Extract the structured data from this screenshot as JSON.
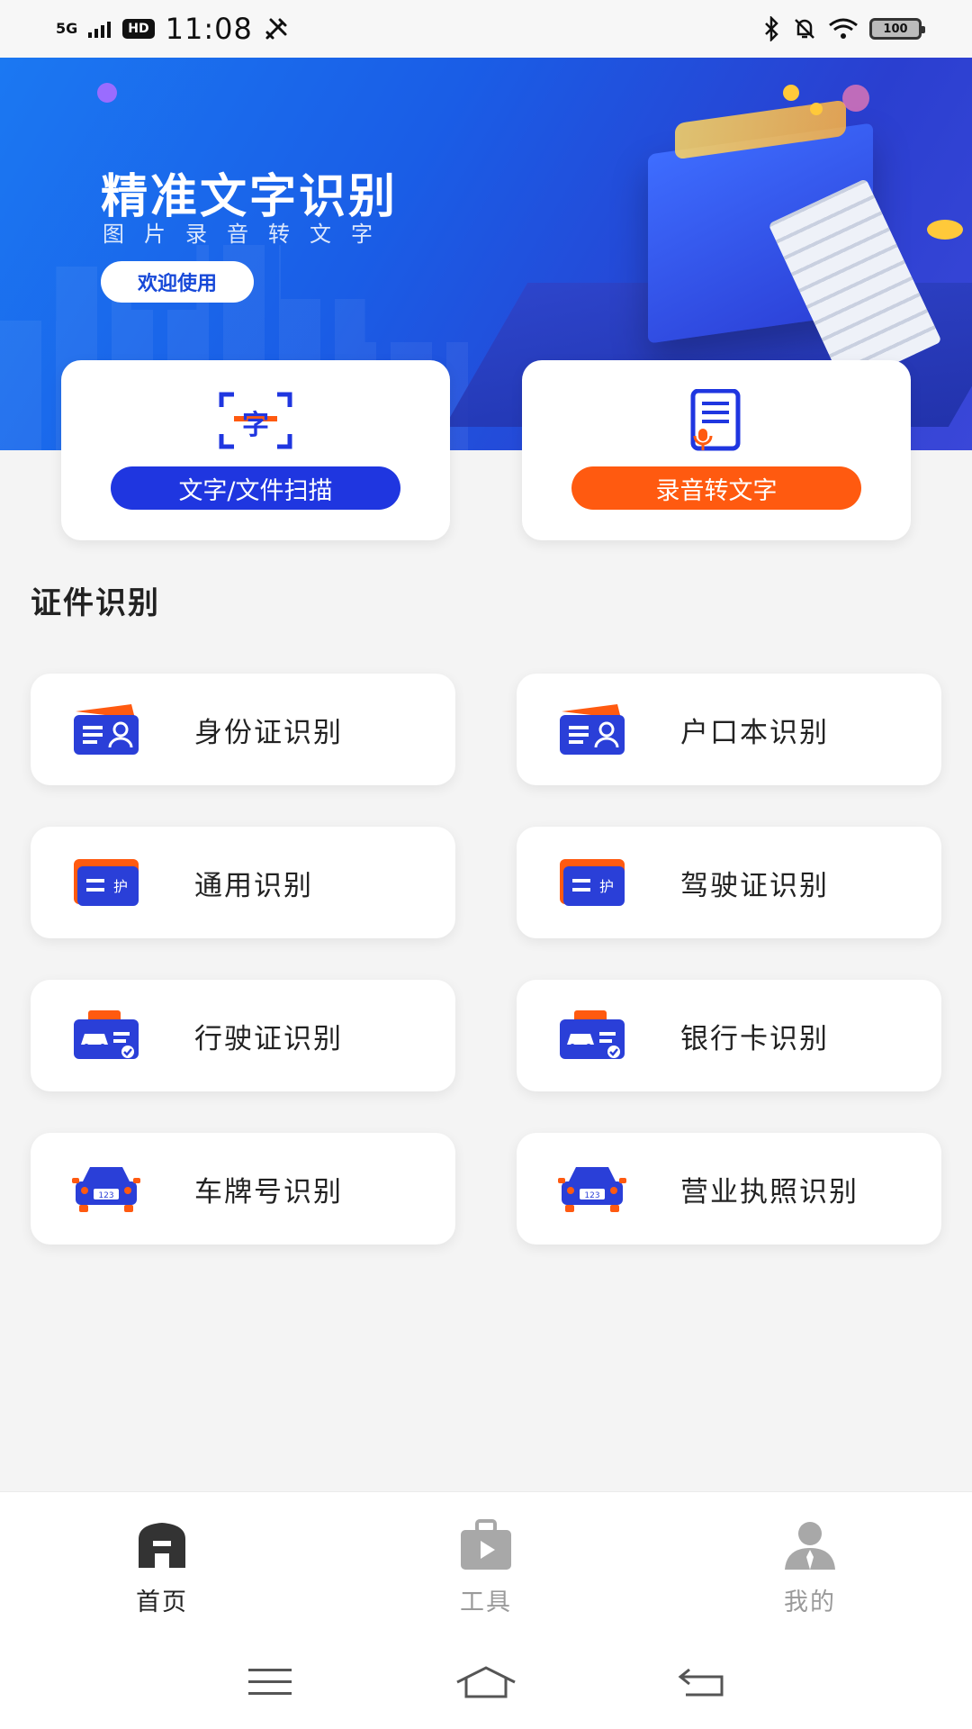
{
  "status_bar": {
    "signal": "5G",
    "hd": "HD",
    "time": "11:08",
    "battery": "100"
  },
  "banner": {
    "title": "精准文字识别",
    "subtitle": "图片录音转文字",
    "welcome_button": "欢迎使用"
  },
  "quick_actions": {
    "scan": {
      "label": "文字/文件扫描",
      "color": "#1f36e0"
    },
    "audio": {
      "label": "录音转文字",
      "color": "#ff5a10"
    }
  },
  "section": {
    "title": "证件识别"
  },
  "id_items": [
    {
      "label": "身份证识别",
      "icon": "id-card-icon"
    },
    {
      "label": "户口本识别",
      "icon": "household-book-icon"
    },
    {
      "label": "通用识别",
      "icon": "passport-icon"
    },
    {
      "label": "驾驶证识别",
      "icon": "driver-license-icon"
    },
    {
      "label": "行驶证识别",
      "icon": "vehicle-license-icon"
    },
    {
      "label": "银行卡识别",
      "icon": "bank-card-icon"
    },
    {
      "label": "车牌号识别",
      "icon": "license-plate-icon"
    },
    {
      "label": "营业执照识别",
      "icon": "business-license-icon"
    }
  ],
  "bottom_nav": {
    "items": [
      {
        "label": "首页",
        "active": true
      },
      {
        "label": "工具",
        "active": false
      },
      {
        "label": "我的",
        "active": false
      }
    ]
  },
  "plate_text": "123"
}
